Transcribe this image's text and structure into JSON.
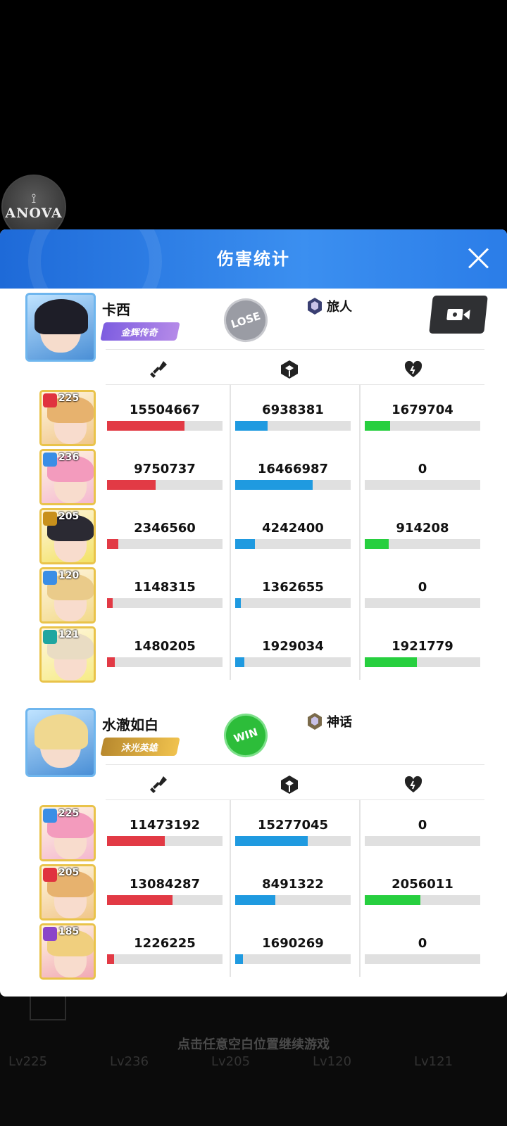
{
  "logo_text": "ANOVA",
  "background": {
    "hint": "点击任意空白位置继续游戏",
    "levels": [
      "Lv225",
      "Lv236",
      "Lv205",
      "Lv120",
      "Lv121"
    ]
  },
  "panel": {
    "title": "伤害统计",
    "close_icon": "close-icon"
  },
  "columns": [
    {
      "icon": "sword-icon",
      "meaning": "damage"
    },
    {
      "icon": "shield-icon",
      "meaning": "damage-taken"
    },
    {
      "icon": "heart-icon",
      "meaning": "healing"
    }
  ],
  "teams": [
    {
      "player": "卡西",
      "rank_badge": "金辉传奇",
      "result": "LOSE",
      "title_tag": "旅人",
      "replay_icon": "video-camera-icon",
      "heroes": [
        {
          "level": "225",
          "element": "fire",
          "element_color": "#e0333f",
          "card": "#f0c68a",
          "hair": "#e7b26e",
          "damage": "15504667",
          "damage_pct": 67,
          "taken": "6938381",
          "taken_pct": 28,
          "heal": "1679704",
          "heal_pct": 22
        },
        {
          "level": "236",
          "element": "ice",
          "element_color": "#3a8ee6",
          "card": "#f4b8d0",
          "hair": "#f39bbd",
          "damage": "9750737",
          "damage_pct": 42,
          "taken": "16466987",
          "taken_pct": 67,
          "heal": "0",
          "heal_pct": 0
        },
        {
          "level": "205",
          "element": "light",
          "element_color": "#c8901c",
          "card": "#f3e266",
          "hair": "#2b2a33",
          "damage": "2346560",
          "damage_pct": 10,
          "taken": "4242400",
          "taken_pct": 17,
          "heal": "914208",
          "heal_pct": 21
        },
        {
          "level": "120",
          "element": "ice",
          "element_color": "#3a8ee6",
          "card": "#f2d98a",
          "hair": "#eacb8a",
          "damage": "1148315",
          "damage_pct": 5,
          "taken": "1362655",
          "taken_pct": 5,
          "heal": "0",
          "heal_pct": 0
        },
        {
          "level": "121",
          "element": "water",
          "element_color": "#1fa6a0",
          "card": "#f6ec86",
          "hair": "#e9dcc3",
          "damage": "1480205",
          "damage_pct": 7,
          "taken": "1929034",
          "taken_pct": 8,
          "heal": "1921779",
          "heal_pct": 45
        }
      ]
    },
    {
      "player": "水澈如白",
      "rank_badge": "沐光英雄",
      "result": "WIN",
      "title_tag": "神话",
      "heroes": [
        {
          "level": "225",
          "element": "ice",
          "element_color": "#3a8ee6",
          "card": "#f4b8d0",
          "hair": "#f39bbd",
          "damage": "11473192",
          "damage_pct": 50,
          "taken": "15277045",
          "taken_pct": 63,
          "heal": "0",
          "heal_pct": 0
        },
        {
          "level": "205",
          "element": "fire",
          "element_color": "#e0333f",
          "card": "#f0c68a",
          "hair": "#e7b26e",
          "damage": "13084287",
          "damage_pct": 57,
          "taken": "8491322",
          "taken_pct": 35,
          "heal": "2056011",
          "heal_pct": 48
        },
        {
          "level": "185",
          "element": "dark",
          "element_color": "#8b45c9",
          "card": "#f1a9b6",
          "hair": "#f0cf7e",
          "damage": "1226225",
          "damage_pct": 6,
          "taken": "1690269",
          "taken_pct": 7,
          "heal": "0",
          "heal_pct": 0
        }
      ]
    }
  ]
}
